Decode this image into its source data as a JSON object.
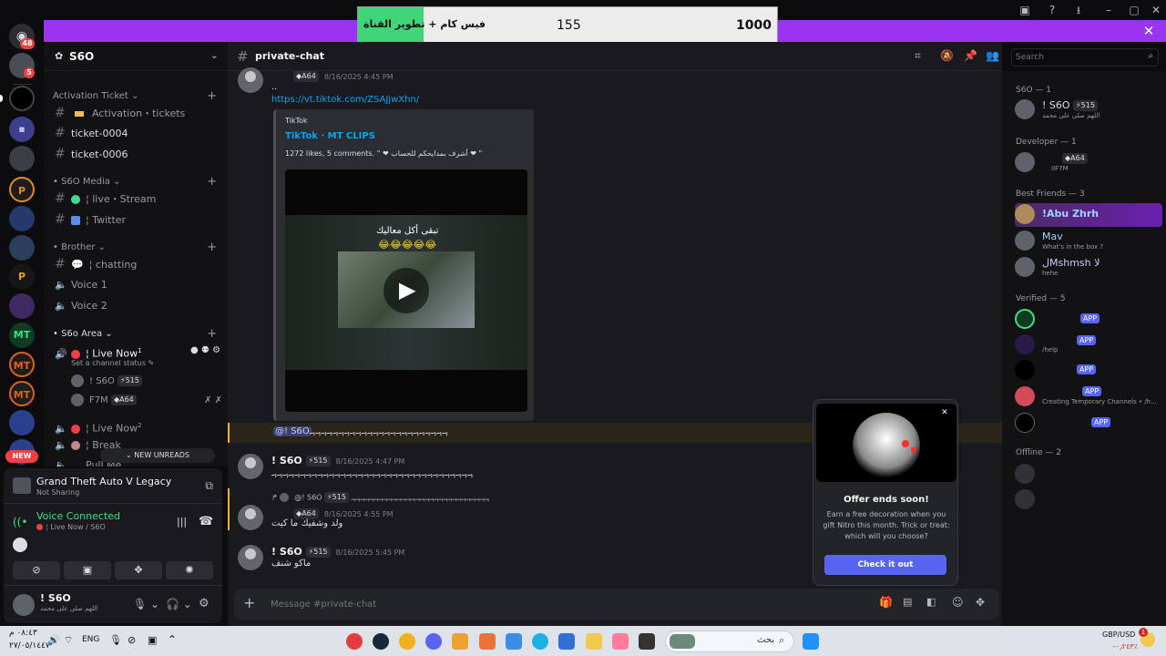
{
  "overlay": {
    "left_label": "فيس كام + تطوير القناة",
    "mid_value": "155",
    "right_value": "1000"
  },
  "rail": {
    "top_badge": "48",
    "second_badge": "5",
    "new_label": "NEW"
  },
  "server": {
    "name": "S6O"
  },
  "categories": [
    {
      "name": "Activation Ticket",
      "channels": [
        "Activation・tickets",
        "ticket-0004",
        "ticket-0006"
      ]
    },
    {
      "name": "S6O Media",
      "channels": [
        "live・Stream",
        "Twitter"
      ]
    },
    {
      "name": "Brother",
      "channels": [
        "chatting",
        "Voice 1",
        "Voice 2"
      ]
    },
    {
      "name": "S6o Area"
    }
  ],
  "area": {
    "live1": "Live Now",
    "live1_sup": "1",
    "status_prompt": "Set a channel status",
    "user1": "! S6O",
    "user1_tag": "515",
    "user2": "F7M",
    "user2_tag": "A64",
    "live2": "Live Now",
    "live2_sup": "2",
    "break_label": "Break",
    "pull_label": "Pull Me"
  },
  "new_unreads": "NEW UNREADS",
  "activity": {
    "game": "Grand Theft Auto V Legacy",
    "sub": "Not Sharing"
  },
  "voice": {
    "status": "Voice Connected",
    "channel": "Live Now / S6O"
  },
  "self": {
    "name": "! S6O",
    "status": "اللهم صلي على محمد"
  },
  "chat": {
    "channel": "private-chat",
    "m0_tag": "A64",
    "m0_time": "8/16/2025 4:45 PM",
    "m0_text": "..",
    "link": "https://vt.tiktok.com/ZSAJjwXhn/",
    "embed_provider": "TikTok",
    "embed_title": "TikTok · MT CLIPS",
    "embed_desc": "1272 likes, 5 comments. \" ❤ أشرف بمدايحكم للحساب ❤ \"",
    "video_caption": "تبقى أكل معاليك",
    "mention_user": "@! S6O",
    "mention_text": "ﮩـﮩـﮩـﮩـﮩـﮩـﮩـﮩـﮩـﮩـﮩـﮩـﮩـﮩـﮩـﮩـﮩـﮩـﮩـﮩـﮩـﮩـﮩـﮩـ",
    "m1_user": "! S6O",
    "m1_tag": "515",
    "m1_time": "8/16/2025 4:47 PM",
    "m1_text": "ﮩـﮩـﮩـﮩـﮩـﮩـﮩـﮩـﮩـﮩـﮩـﮩـﮩـﮩـﮩـﮩـﮩـﮩـﮩـﮩـﮩـﮩـﮩـﮩـﮩـﮩـﮩـﮩـﮩـﮩـﮩـﮩـﮩـﮩـﮩـ",
    "r_user": "@! S6O",
    "r_tag": "515",
    "r_text": "ﮩـﮩـﮩـﮩـﮩـﮩـﮩـﮩـﮩـﮩـﮩـﮩـﮩـﮩـﮩـﮩـﮩـﮩـﮩـﮩـﮩـﮩـﮩـﮩـﮩـﮩـﮩـﮩـﮩـﮩـ",
    "m2_tag": "A64",
    "m2_time": "8/16/2025 4:55 PM",
    "m2_text": "ولد وشفيك ما كيت",
    "m3_user": "! S6O",
    "m3_tag": "515",
    "m3_time": "8/16/2025 5:45 PM",
    "m3_text": "ماكو شنف",
    "composer_placeholder": "Message #private-chat"
  },
  "search": {
    "placeholder": "Search"
  },
  "members": {
    "g1": "S6O — 1",
    "g1_name": "! S6O",
    "g1_tag": "515",
    "g1_sub": "اللهم صلي على محمد",
    "g2": "Developer — 1",
    "g2_tag": "A64",
    "g2_sub": "IIF7M",
    "g3": "Best Friends — 3",
    "bf1": "!Abu Zhrh",
    "bf2": "Mav",
    "bf2_sub": "What's in the box ?",
    "bf3": "لMshmsh لا",
    "bf3_sub": "hehe",
    "g4": "Verified — 5",
    "app_label": "APP",
    "v2_sub": "/help",
    "v4_sub": "Creating Temporary Channels • /h...",
    "g5": "Offline — 2"
  },
  "popup": {
    "title": "Offer ends soon!",
    "body": "Earn a free decoration when you gift Nitro this month. Trick or treat: which will you choose?",
    "cta": "Check it out"
  },
  "taskbar": {
    "time": "٠٨:٤٣ م",
    "date": "٢٧/٠٥/١٤٤٧",
    "lang": "ENG",
    "search": "بحث",
    "fx_pair": "GBP/USD",
    "fx_change": "-٠٫٢٤٣٪"
  }
}
